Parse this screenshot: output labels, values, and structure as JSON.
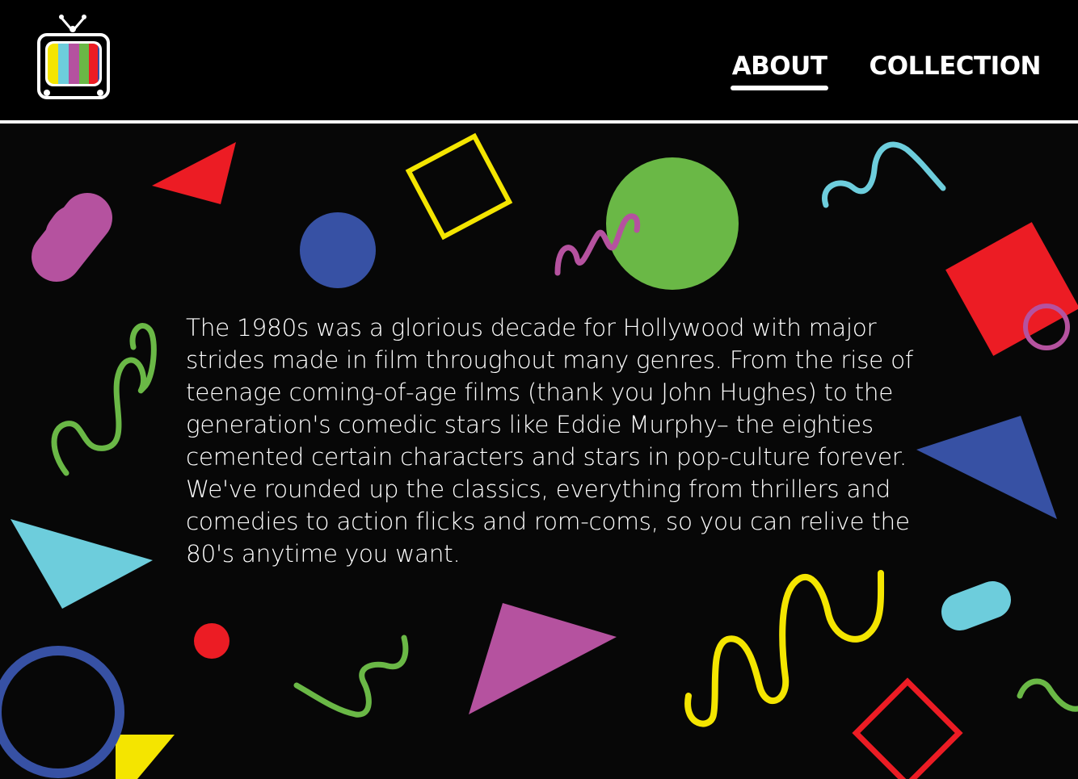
{
  "header": {
    "logo_icon": "retro-tv-icon",
    "nav": [
      {
        "label": "ABOUT",
        "active": true
      },
      {
        "label": "COLLECTION",
        "active": false
      }
    ]
  },
  "main": {
    "intro_text": "The 1980s was a glorious decade for Hollywood with major strides made in film throughout many genres. From the rise of teenage coming-of-age films (thank you John Hughes) to the generation's comedic stars like Eddie Murphy– the eighties cemented certain characters and stars in pop-culture forever. We've rounded up the classics, everything from thrillers and comedies to action flicks and rom-coms, so you can relive the 80's anytime you want."
  },
  "colors": {
    "background": "#070707",
    "red": "#ec1c24",
    "yellow": "#f4e500",
    "green": "#6ab846",
    "blue": "#3751a4",
    "cyan": "#6dcddc",
    "purple": "#b5529f"
  }
}
